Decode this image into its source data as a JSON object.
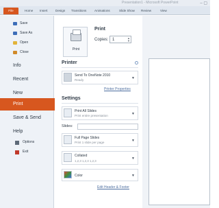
{
  "titlebar": {
    "doc_title": "Presentation1 - Microsoft PowerPoint"
  },
  "ribbon": {
    "tabs": [
      "File",
      "Home",
      "Insert",
      "Design",
      "Transitions",
      "Animations",
      "Slide Show",
      "Review",
      "View"
    ]
  },
  "nav": {
    "quick": [
      {
        "label": "Save",
        "icon": "save-icon",
        "color": "#3d6eb8"
      },
      {
        "label": "Save As",
        "icon": "save-as-icon",
        "color": "#3d6eb8"
      },
      {
        "label": "Open",
        "icon": "folder-icon",
        "color": "#e2b43a"
      },
      {
        "label": "Close",
        "icon": "close-file-icon",
        "color": "#d08a2a"
      }
    ],
    "items": [
      "Info",
      "Recent",
      "New",
      "Print",
      "Save & Send",
      "Help"
    ],
    "active": "Print",
    "sub": [
      {
        "label": "Options",
        "icon": "options-icon",
        "color": "#5d6a78"
      },
      {
        "label": "Exit",
        "icon": "exit-icon",
        "color": "#c0392b"
      }
    ]
  },
  "print": {
    "title": "Print",
    "button_label": "Print",
    "copies_label": "Copies:",
    "copies_value": "1"
  },
  "printer": {
    "heading": "Printer",
    "name": "Send To OneNote 2010",
    "status": "Ready",
    "properties_link": "Printer Properties"
  },
  "settings": {
    "heading": "Settings",
    "range_title": "Print All Slides",
    "range_sub": "Print entire presentation",
    "slides_label": "Slides:",
    "layout_title": "Full Page Slides",
    "layout_sub": "Print 1 slide per page",
    "collate_title": "Collated",
    "collate_sub": "1,2,3   1,2,3   1,2,3",
    "color_title": "Color",
    "edit_link": "Edit Header & Footer"
  }
}
